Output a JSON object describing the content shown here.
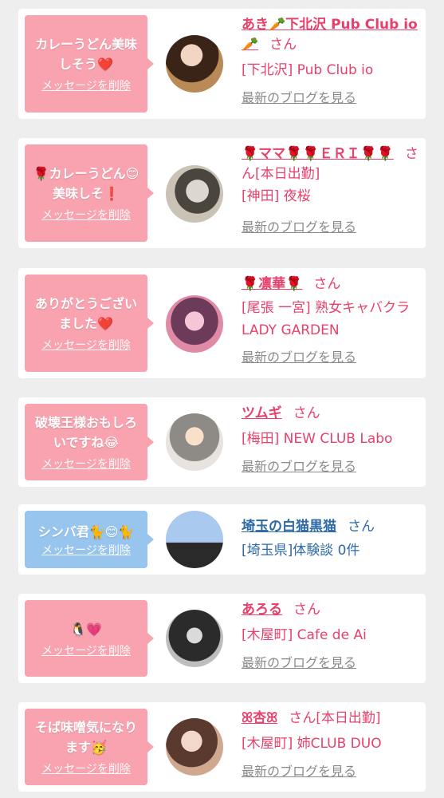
{
  "colors": {
    "pink": "#f9a2b0",
    "blue": "#97c5ee",
    "name_pink": "#e8406b",
    "name_blue": "#2d6aa8",
    "link_gray": "#8a8a8a"
  },
  "delete_label": "メッセージを削除",
  "san_label": "さん",
  "blog_label": "最新のブログを見る",
  "cards": [
    {
      "message": "カレーうどん美味しそう❤️",
      "name": "あき🥕下北沢 Pub Club io🥕",
      "extra": "",
      "shop": "[下北沢] Pub Club io",
      "has_blog": true
    },
    {
      "message": "🌹カレーうどん😊美味しそ❗",
      "name": "🌹ママ🌹🌹ＥＲＩ🌹🌹",
      "extra": "[本日出勤]",
      "shop": "[神田] 夜桜",
      "has_blog": true
    },
    {
      "message": "ありがとうございました❤️",
      "name": "🌹凛華🌹",
      "extra": "",
      "shop": "[尾張 一宮] 熟女キャバクラ LADY GARDEN",
      "has_blog": true
    },
    {
      "message": "破壊王様おもしろいですね😂",
      "name": "ツムギ",
      "extra": "",
      "shop": "[梅田] NEW CLUB Labo",
      "has_blog": true
    },
    {
      "message": "シンバ君🐈😊🐈",
      "name": "埼玉の白猫黒猫",
      "extra": "",
      "shop": "[埼玉県]体験談 0件",
      "has_blog": false
    },
    {
      "message": "🐧💗",
      "name": "あろる",
      "extra": "",
      "shop": "[木屋町] Cafe de Ai",
      "has_blog": true
    },
    {
      "message": "そば味噌気になります🥳",
      "name": "ꕤ杏ꕤ",
      "extra": "[本日出勤]",
      "shop": "[木屋町] 姉CLUB DUO",
      "has_blog": true
    }
  ]
}
